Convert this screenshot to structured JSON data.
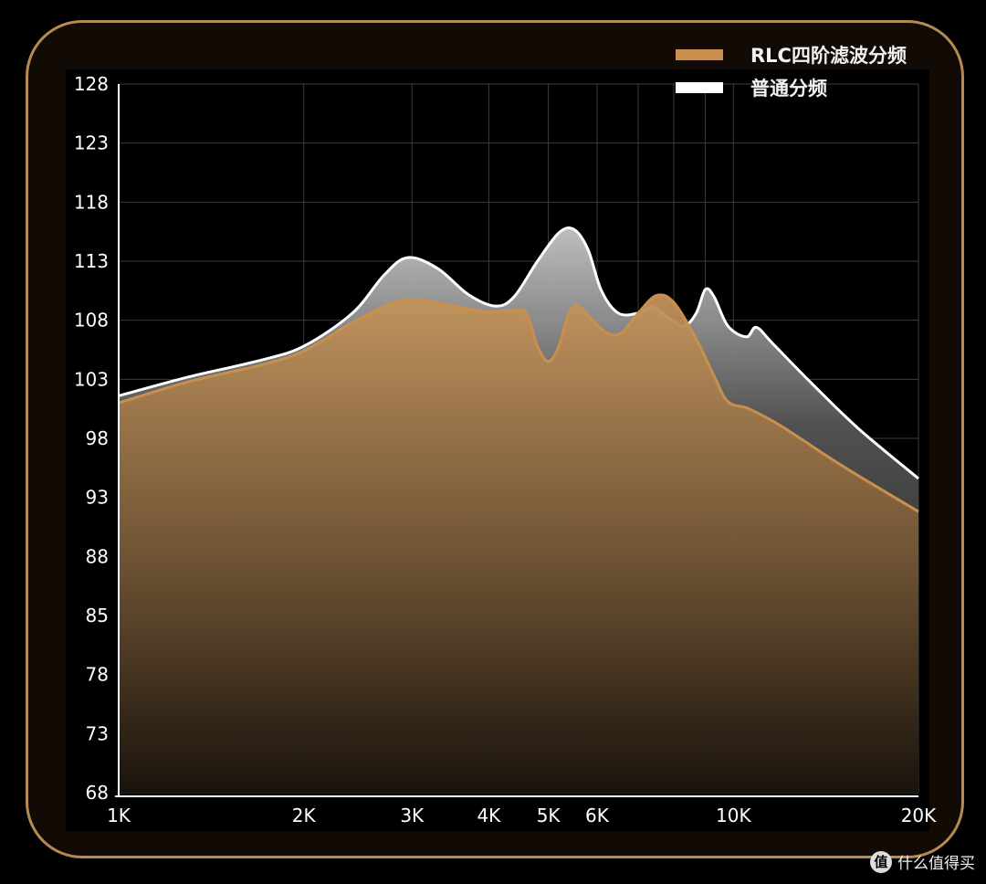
{
  "watermark": {
    "icon": "zhi-logo-icon",
    "text": "什么值得买"
  },
  "chart_data": {
    "type": "area",
    "title": "",
    "xlabel": "",
    "ylabel": "",
    "x_scale": "log",
    "x_ticks": [
      {
        "value": 1000,
        "label": "1K"
      },
      {
        "value": 2000,
        "label": "2K"
      },
      {
        "value": 3000,
        "label": "3K"
      },
      {
        "value": 4000,
        "label": "4K"
      },
      {
        "value": 5000,
        "label": "5K"
      },
      {
        "value": 6000,
        "label": "6K"
      },
      {
        "value": 10000,
        "label": "10K"
      },
      {
        "value": 20000,
        "label": "20K"
      }
    ],
    "x_minor_grid": [
      7000,
      8000,
      9000
    ],
    "y_tick_labels": [
      "128",
      "123",
      "118",
      "113",
      "108",
      "103",
      "98",
      "93",
      "88",
      "85",
      "78",
      "73",
      "68"
    ],
    "grid": true,
    "legend_position": "top-right",
    "series": [
      {
        "name": "普通分频",
        "color": "#ffffff",
        "points": [
          [
            1000,
            101.6
          ],
          [
            1300,
            103.2
          ],
          [
            1700,
            104.6
          ],
          [
            2000,
            105.8
          ],
          [
            2400,
            108.6
          ],
          [
            2700,
            111.8
          ],
          [
            2950,
            113.3
          ],
          [
            3300,
            112.4
          ],
          [
            3700,
            110.2
          ],
          [
            4100,
            109.2
          ],
          [
            4400,
            110.0
          ],
          [
            4800,
            113.0
          ],
          [
            5200,
            115.4
          ],
          [
            5500,
            115.7
          ],
          [
            5800,
            114.0
          ],
          [
            6100,
            110.5
          ],
          [
            6500,
            108.6
          ],
          [
            7000,
            108.6
          ],
          [
            7400,
            109.1
          ],
          [
            7800,
            108.3
          ],
          [
            8300,
            107.5
          ],
          [
            8700,
            108.6
          ],
          [
            9000,
            110.6
          ],
          [
            9300,
            110.0
          ],
          [
            9800,
            107.5
          ],
          [
            10500,
            106.6
          ],
          [
            10900,
            107.4
          ],
          [
            11600,
            106.0
          ],
          [
            13500,
            102.5
          ],
          [
            16000,
            98.8
          ],
          [
            20000,
            94.6
          ]
        ]
      },
      {
        "name": "RLC四阶滤波分频",
        "color": "#c8904c",
        "points": [
          [
            1000,
            101.0
          ],
          [
            1300,
            102.8
          ],
          [
            1700,
            104.2
          ],
          [
            2000,
            105.4
          ],
          [
            2400,
            107.8
          ],
          [
            2800,
            109.5
          ],
          [
            3100,
            109.7
          ],
          [
            3500,
            109.2
          ],
          [
            4000,
            108.7
          ],
          [
            4300,
            108.8
          ],
          [
            4600,
            108.6
          ],
          [
            4800,
            105.8
          ],
          [
            5000,
            104.5
          ],
          [
            5200,
            105.8
          ],
          [
            5400,
            108.6
          ],
          [
            5600,
            109.2
          ],
          [
            6000,
            107.6
          ],
          [
            6300,
            106.8
          ],
          [
            6600,
            107.0
          ],
          [
            7000,
            108.6
          ],
          [
            7500,
            110.1
          ],
          [
            8000,
            109.5
          ],
          [
            8700,
            106.4
          ],
          [
            9300,
            103.3
          ],
          [
            9800,
            101.1
          ],
          [
            10600,
            100.5
          ],
          [
            12000,
            99.0
          ],
          [
            15000,
            95.7
          ],
          [
            20000,
            91.8
          ]
        ]
      }
    ]
  }
}
